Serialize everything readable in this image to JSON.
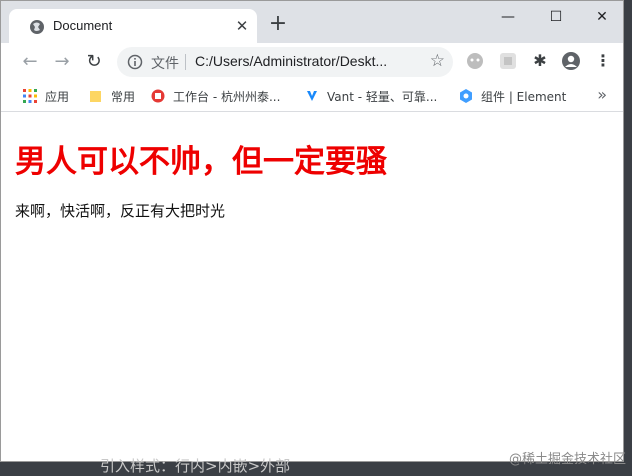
{
  "browser": {
    "tab": {
      "title": "Document",
      "close": "✕"
    },
    "new_tab": "+",
    "window_controls": {
      "minimize": "—",
      "maximize": "☐",
      "close": "✕"
    },
    "nav": {
      "back": "←",
      "forward": "→",
      "reload": "↻"
    },
    "omnibox": {
      "scheme_label": "文件",
      "url": "C:/Users/Administrator/Deskt...",
      "star": "☆"
    },
    "extensions": {
      "puzzle": "✱",
      "more": "⋮"
    },
    "bookmarks": [
      {
        "label": "应用",
        "icon": "apps-grid-icon"
      },
      {
        "label": "常用",
        "icon": "folder-icon"
      },
      {
        "label": "工作台 - 杭州州泰...",
        "icon": "workbench-icon"
      },
      {
        "label": "Vant - 轻量、可靠...",
        "icon": "vant-icon"
      },
      {
        "label": "组件 | Element",
        "icon": "element-icon"
      }
    ],
    "bookmarks_more": "»"
  },
  "page": {
    "heading": "男人可以不帅，但一定要骚",
    "paragraph": "来啊，快活啊，反正有大把时光"
  },
  "background": {
    "text": "引入样式：行内>内嵌>外部",
    "watermark": "@稀土掘金技术社区"
  },
  "colors": {
    "heading": "#ee0000",
    "tabstrip": "#dee1e6"
  }
}
